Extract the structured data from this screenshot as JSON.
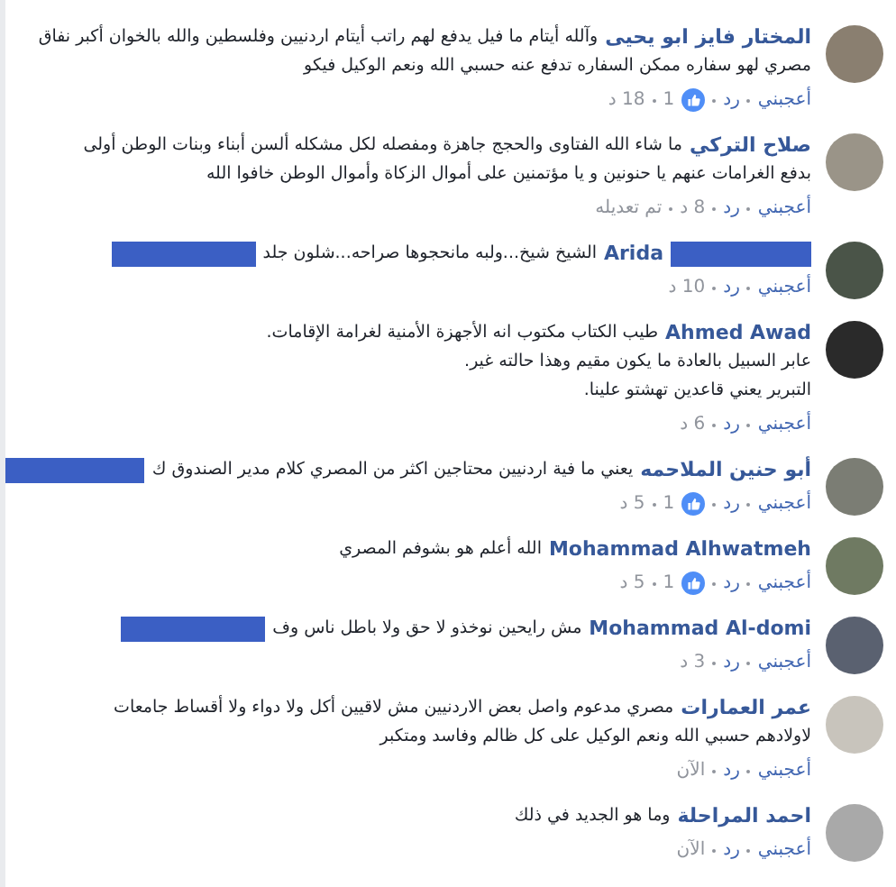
{
  "comments": [
    {
      "author": "المختار فايز ابو يحيى",
      "lines": [
        "وآلله أيتام ما فيل يدفع لهم راتب أيتام اردنيين وفلسطين والله بالخوان أكبر نفاق",
        "مصري لهو سفاره ممكن السفاره تدفع عنه حسبي الله ونعم الوكيل فيكو"
      ],
      "like": "أعجبني",
      "reply": "رد",
      "likes": "1",
      "time": "18 د"
    },
    {
      "author": "صلاح التركي",
      "lines": [
        "ما شاء الله الفتاوى والحجج جاهزة ومفصله لكل مشكله ألسن أبناء وبنات الوطن أولى",
        "بدفع الغرامات عنهم يا حنونين و يا مؤتمنين على أموال الزكاة وأموال الوطن خافوا الله"
      ],
      "like": "أعجبني",
      "reply": "رد",
      "time": "8 د",
      "edited": "تم تعديله"
    },
    {
      "author": "Arida",
      "lines": [
        "الشيخ شيخ...ولبه مانحجوها صراحه...شلون جلد"
      ],
      "redact_name": true,
      "redact_end": true,
      "like": "أعجبني",
      "reply": "رد",
      "time": "10 د"
    },
    {
      "author": "Ahmed Awad",
      "lines": [
        "طيب الكتاب مكتوب انه الأجهزة الأمنية لغرامة الإقامات.",
        "عابر السبيل بالعادة ما يكون مقيم وهذا حالته غير.",
        "التبرير يعني قاعدين تهشتو علينا."
      ],
      "like": "أعجبني",
      "reply": "رد",
      "time": "6 د"
    },
    {
      "author": "أبو حنين الملاحمه",
      "lines": [
        "يعني ما فية اردنيين محتاجين اكثر من المصري كلام مدير الصندوق ك"
      ],
      "redact_end": true,
      "like": "أعجبني",
      "reply": "رد",
      "likes": "1",
      "time": "5 د"
    },
    {
      "author": "Mohammad Alhwatmeh",
      "lines": [
        "الله أعلم هو بشوفم المصري"
      ],
      "like": "أعجبني",
      "reply": "رد",
      "likes": "1",
      "time": "5 د"
    },
    {
      "author": "Mohammad Al-domi",
      "lines": [
        "مش رايحين نوخذو لا حق ولا باطل ناس وف"
      ],
      "redact_end": true,
      "like": "أعجبني",
      "reply": "رد",
      "time": "3 د"
    },
    {
      "author": "عمر العمارات",
      "lines": [
        "مصري مدعوم واصل بعض الاردنيين مش لاقيين أكل ولا دواء ولا أقساط جامعات",
        "لاولادهم حسبي الله ونعم الوكيل على كل ظالم وفاسد ومتكبر"
      ],
      "like": "أعجبني",
      "reply": "رد",
      "time": "الآن"
    },
    {
      "author": "احمد المراحلة",
      "lines": [
        "وما هو الجديد في ذلك"
      ],
      "like": "أعجبني",
      "reply": "رد",
      "time": "الآن"
    }
  ]
}
